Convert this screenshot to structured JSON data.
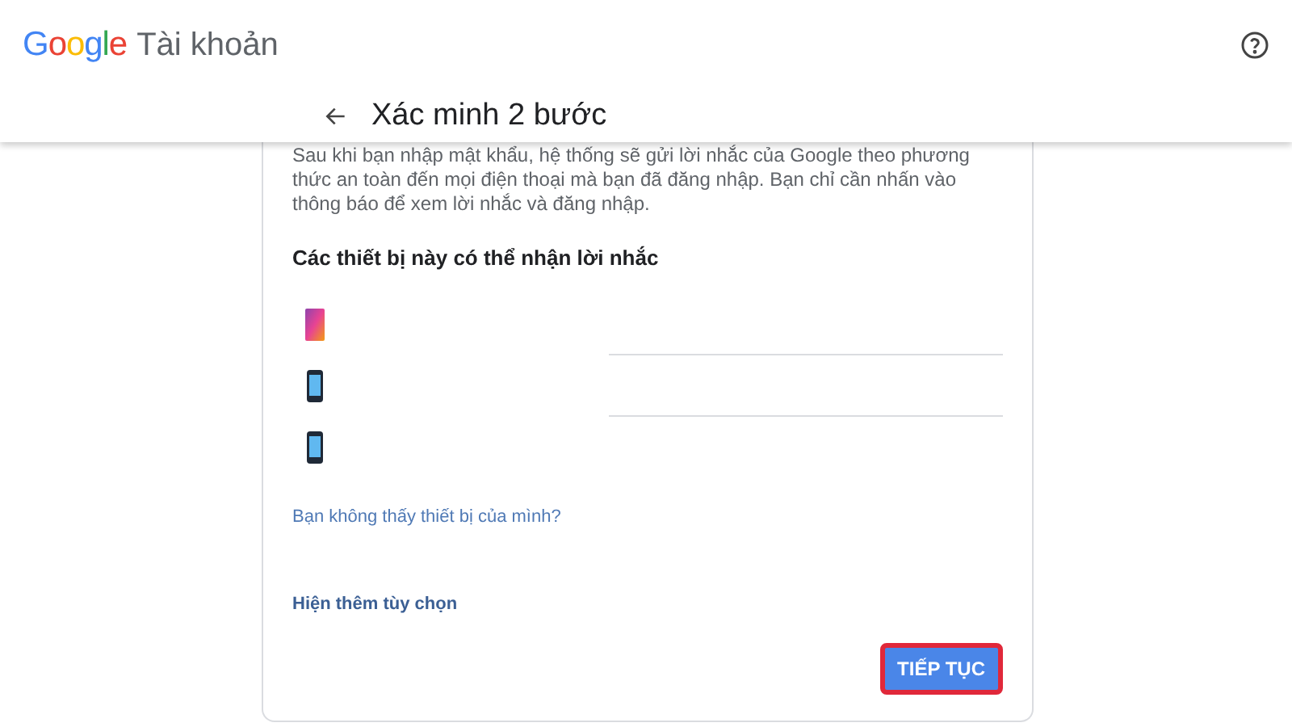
{
  "header": {
    "logo": "Google",
    "product": "Tài khoản"
  },
  "page": {
    "title": "Xác minh 2 bước"
  },
  "intro": "Sau khi bạn nhập mật khẩu, hệ thống sẽ gửi lời nhắc của Google theo phương thức an toàn đến mọi điện thoại mà bạn đã đăng nhập. Bạn chỉ cần nhấn vào thông báo để xem lời nhắc và đăng nhập.",
  "devices_heading": "Các thiết bị này có thể nhận lời nhắc",
  "devices": [
    {
      "kind": "tablet"
    },
    {
      "kind": "phone"
    },
    {
      "kind": "phone"
    }
  ],
  "missing_device_link": "Bạn không thấy thiết bị của mình?",
  "more_options_link": "Hiện thêm tùy chọn",
  "continue_button": {
    "label": "TIẾP TỤC",
    "highlighted": true
  }
}
